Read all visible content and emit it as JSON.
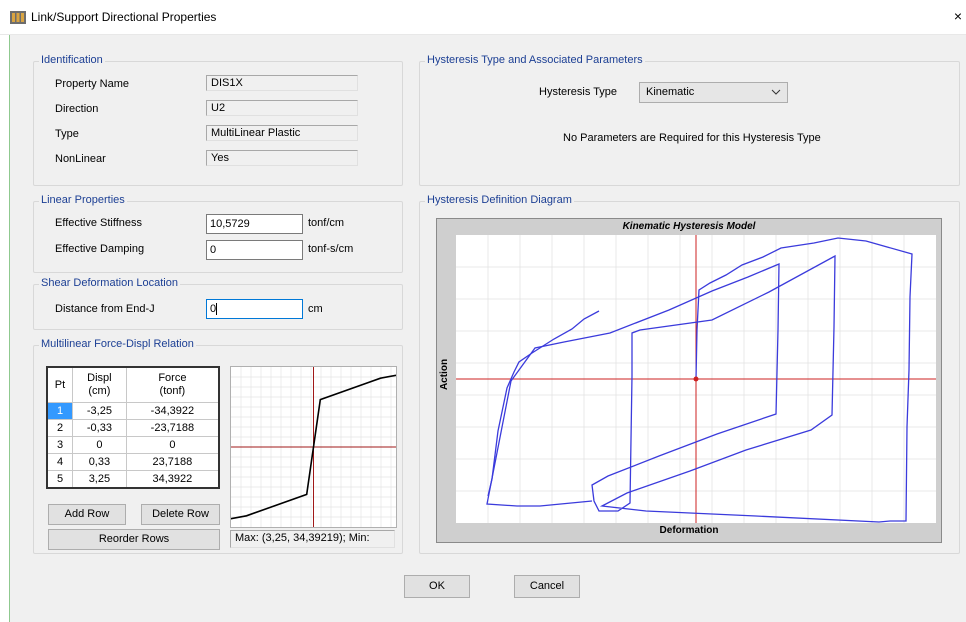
{
  "window": {
    "title": "Link/Support Directional Properties",
    "close_glyph": "×"
  },
  "identification": {
    "title": "Identification",
    "rows": [
      {
        "label": "Property Name",
        "value": "DIS1X"
      },
      {
        "label": "Direction",
        "value": "U2"
      },
      {
        "label": "Type",
        "value": "MultiLinear Plastic"
      },
      {
        "label": "NonLinear",
        "value": "Yes"
      }
    ]
  },
  "linear": {
    "title": "Linear Properties",
    "stiffness_label": "Effective Stiffness",
    "stiffness_value": "10,5729",
    "stiffness_unit": "tonf/cm",
    "damping_label": "Effective Damping",
    "damping_value": "0",
    "damping_unit": "tonf-s/cm"
  },
  "shear": {
    "title": "Shear Deformation Location",
    "label": "Distance from End-J",
    "value": "0",
    "unit": "cm"
  },
  "multilinear": {
    "title": "Multilinear Force-Displ Relation",
    "headers": {
      "pt": "Pt",
      "displ": "Displ",
      "displ_unit": "(cm)",
      "force": "Force",
      "force_unit": "(tonf)"
    },
    "rows": [
      {
        "pt": "1",
        "displ": "-3,25",
        "force": "-34,3922"
      },
      {
        "pt": "2",
        "displ": "-0,33",
        "force": "-23,7188"
      },
      {
        "pt": "3",
        "displ": "0",
        "force": "0"
      },
      {
        "pt": "4",
        "displ": "0,33",
        "force": "23,7188"
      },
      {
        "pt": "5",
        "displ": "3,25",
        "force": "34,3922"
      }
    ],
    "add_row": "Add Row",
    "delete_row": "Delete Row",
    "reorder_rows": "Reorder Rows",
    "maxmin_text": "Max: (3,25, 34,39219);  Min:"
  },
  "hysteresis": {
    "title": "Hysteresis Type and Associated Parameters",
    "type_label": "Hysteresis Type",
    "type_value": "Kinematic",
    "message": "No Parameters are Required for this Hysteresis Type"
  },
  "diagram": {
    "group_title": "Hysteresis Definition Diagram",
    "title": "Kinematic Hysteresis Model",
    "xlabel": "Deformation",
    "ylabel": "Action"
  },
  "buttons": {
    "ok": "OK",
    "cancel": "Cancel"
  },
  "colors": {
    "group_title": "#1c3f94",
    "curve": "#3b3bdc",
    "axis": "#cc2222",
    "selection": "#3399ff"
  },
  "chart_data": [
    {
      "type": "line",
      "title": "",
      "xlabel": "",
      "ylabel": "",
      "series": [
        {
          "x": [
            -3.25,
            -0.33,
            0,
            0.33,
            3.25
          ],
          "y": [
            -34.3922,
            -23.7188,
            0,
            23.7188,
            34.3922
          ]
        }
      ]
    },
    {
      "type": "line",
      "title": "Kinematic Hysteresis Model",
      "xlabel": "Deformation",
      "ylabel": "Action",
      "grid": true
    }
  ]
}
